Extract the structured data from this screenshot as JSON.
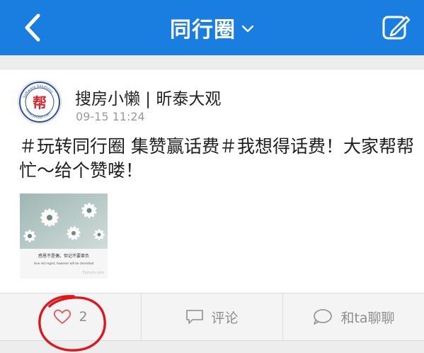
{
  "header": {
    "title": "同行圈",
    "back_icon": "chevron-left-icon",
    "dropdown_icon": "chevron-down-icon",
    "edit_icon": "compose-icon",
    "bg_color": "#1a7de0"
  },
  "post": {
    "author": "搜房小懒 | 昕泰大观",
    "time": "09-15 11:24",
    "content": "＃玩转同行圈 集赞赢话费＃我想得话费！大家帮帮忙～给个赞喽！",
    "avatar_logo_char": "帮",
    "avatar_ring_text_top": "Software Solutions",
    "avatar_ring_text_bottom": "www.soufun.com",
    "image_caption": "感恩不是偶，但记不要辜负",
    "image_subcaption": "love not regret, however will be cherished",
    "image_watermark": "Fpinyin.com"
  },
  "actions": {
    "like_count": "2",
    "comment_label": "评论",
    "chat_label": "和ta聊聊",
    "like_icon": "heart-icon",
    "comment_icon": "comment-icon",
    "chat_icon": "chat-bubble-icon"
  },
  "annotation": {
    "color": "#e0161d"
  }
}
